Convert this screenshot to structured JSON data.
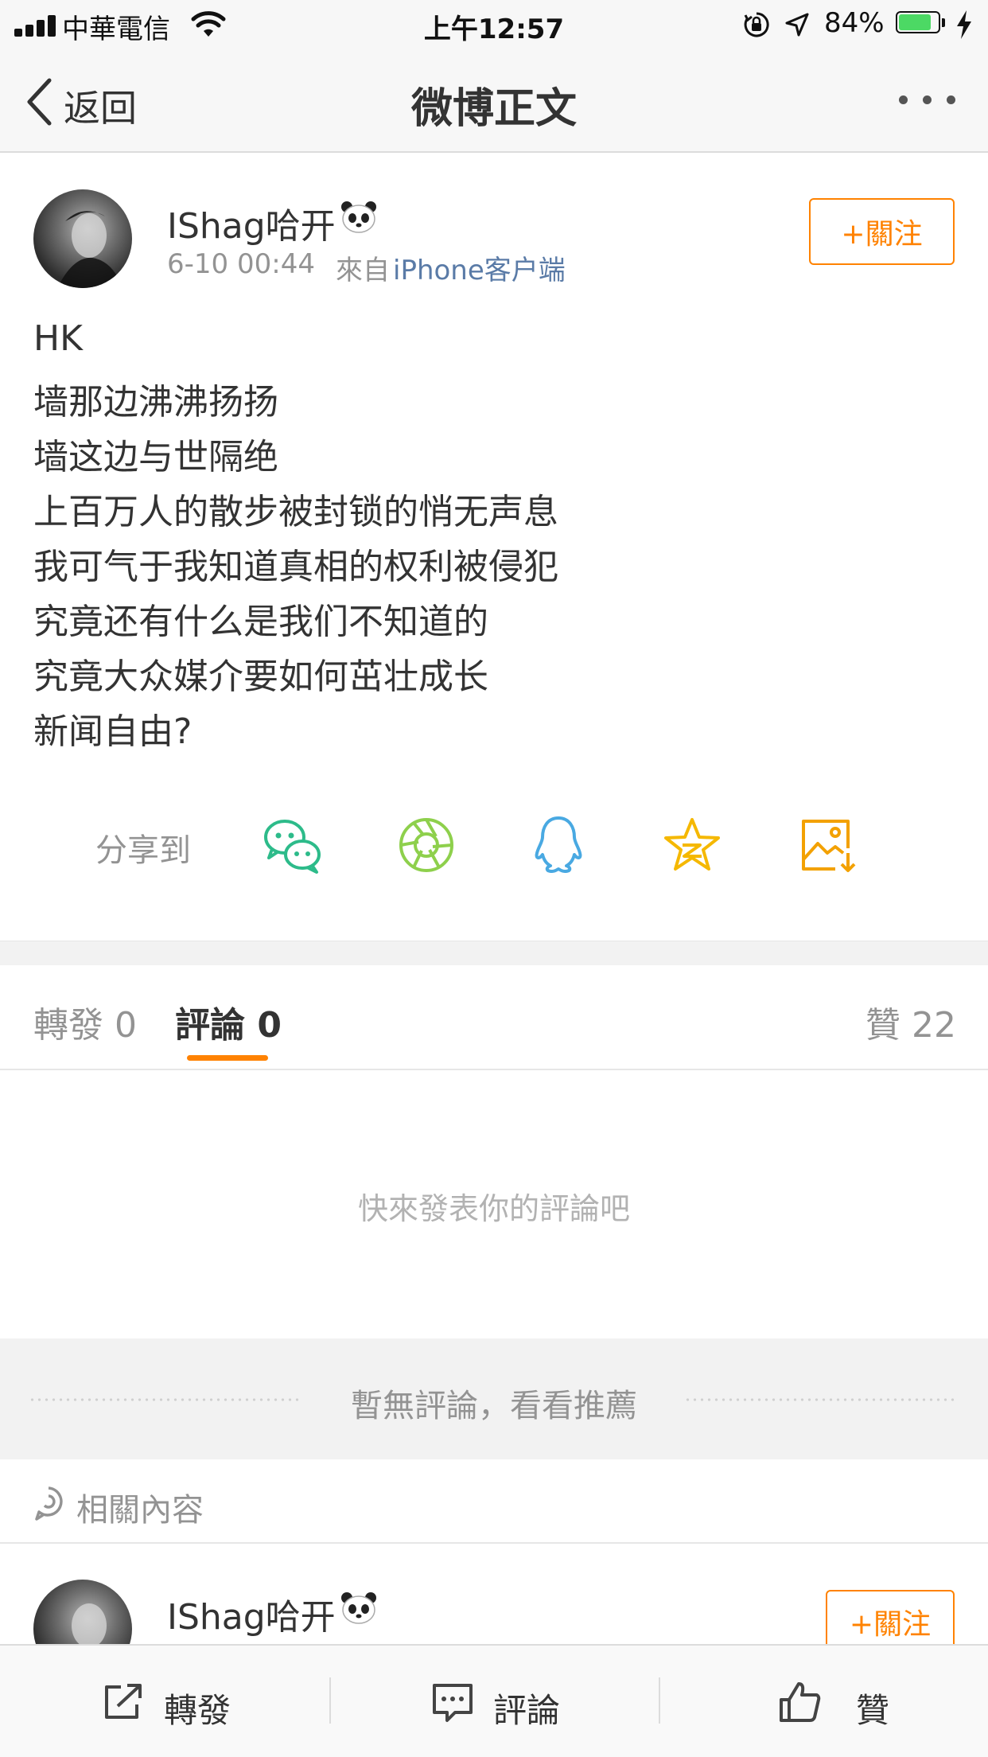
{
  "status_bar": {
    "carrier": "中華電信",
    "time": "上午12:57",
    "battery_percent": "84%",
    "battery_level": 0.84,
    "battery_color": "#4cd964"
  },
  "nav": {
    "back_label": "返回",
    "title": "微博正文",
    "more_icon": "more-dots-icon"
  },
  "post": {
    "username": "IShag哈开",
    "badge_icon": "panda-icon",
    "time": "6-10 00:44",
    "from_label": "來自",
    "source": "iPhone客户端",
    "follow_label": "+關注",
    "lines": [
      "HK",
      "墙那边沸沸扬扬",
      "墙这边与世隔绝",
      "上百万人的散步被封锁的悄无声息",
      "我可气于我知道真相的权利被侵犯",
      "究竟还有什么是我们不知道的",
      "究竟大众媒介要如何茁壮成长",
      "新闻自由?"
    ]
  },
  "share": {
    "label": "分享到",
    "icons": [
      "wechat-icon",
      "moments-icon",
      "qq-icon",
      "qzone-star-icon",
      "save-image-icon"
    ]
  },
  "tabs": {
    "repost": "轉發 0",
    "comment": "評論 0",
    "like": "贊 22"
  },
  "comments": {
    "empty_hint": "快來發表你的評論吧",
    "no_comments": "暫無評論，看看推薦"
  },
  "related": {
    "label": "相關內容",
    "username": "IShag哈开",
    "follow_label": "+關注"
  },
  "toolbar": {
    "repost": "轉發",
    "comment": "評論",
    "like": "贊"
  },
  "colors": {
    "accent": "#ff8200",
    "link": "#5a7ba7",
    "wechat": "#2dbb8a",
    "moments": "#8ed04c",
    "qq": "#49a9e2",
    "qzone": "#f5b800",
    "save": "#f3a100"
  }
}
